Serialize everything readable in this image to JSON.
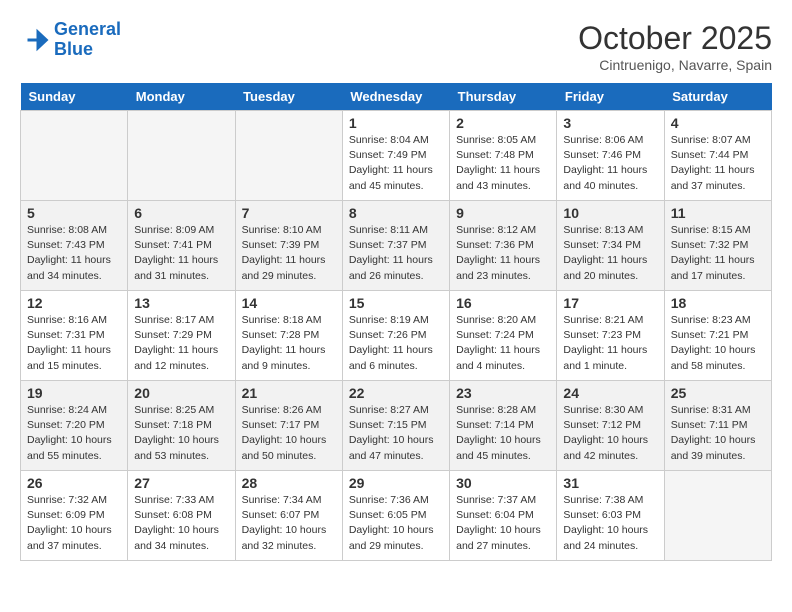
{
  "header": {
    "logo_line1": "General",
    "logo_line2": "Blue",
    "month": "October 2025",
    "location": "Cintruenigo, Navarre, Spain"
  },
  "weekdays": [
    "Sunday",
    "Monday",
    "Tuesday",
    "Wednesday",
    "Thursday",
    "Friday",
    "Saturday"
  ],
  "weeks": [
    [
      {
        "day": "",
        "info": ""
      },
      {
        "day": "",
        "info": ""
      },
      {
        "day": "",
        "info": ""
      },
      {
        "day": "1",
        "info": "Sunrise: 8:04 AM\nSunset: 7:49 PM\nDaylight: 11 hours and 45 minutes."
      },
      {
        "day": "2",
        "info": "Sunrise: 8:05 AM\nSunset: 7:48 PM\nDaylight: 11 hours and 43 minutes."
      },
      {
        "day": "3",
        "info": "Sunrise: 8:06 AM\nSunset: 7:46 PM\nDaylight: 11 hours and 40 minutes."
      },
      {
        "day": "4",
        "info": "Sunrise: 8:07 AM\nSunset: 7:44 PM\nDaylight: 11 hours and 37 minutes."
      }
    ],
    [
      {
        "day": "5",
        "info": "Sunrise: 8:08 AM\nSunset: 7:43 PM\nDaylight: 11 hours and 34 minutes."
      },
      {
        "day": "6",
        "info": "Sunrise: 8:09 AM\nSunset: 7:41 PM\nDaylight: 11 hours and 31 minutes."
      },
      {
        "day": "7",
        "info": "Sunrise: 8:10 AM\nSunset: 7:39 PM\nDaylight: 11 hours and 29 minutes."
      },
      {
        "day": "8",
        "info": "Sunrise: 8:11 AM\nSunset: 7:37 PM\nDaylight: 11 hours and 26 minutes."
      },
      {
        "day": "9",
        "info": "Sunrise: 8:12 AM\nSunset: 7:36 PM\nDaylight: 11 hours and 23 minutes."
      },
      {
        "day": "10",
        "info": "Sunrise: 8:13 AM\nSunset: 7:34 PM\nDaylight: 11 hours and 20 minutes."
      },
      {
        "day": "11",
        "info": "Sunrise: 8:15 AM\nSunset: 7:32 PM\nDaylight: 11 hours and 17 minutes."
      }
    ],
    [
      {
        "day": "12",
        "info": "Sunrise: 8:16 AM\nSunset: 7:31 PM\nDaylight: 11 hours and 15 minutes."
      },
      {
        "day": "13",
        "info": "Sunrise: 8:17 AM\nSunset: 7:29 PM\nDaylight: 11 hours and 12 minutes."
      },
      {
        "day": "14",
        "info": "Sunrise: 8:18 AM\nSunset: 7:28 PM\nDaylight: 11 hours and 9 minutes."
      },
      {
        "day": "15",
        "info": "Sunrise: 8:19 AM\nSunset: 7:26 PM\nDaylight: 11 hours and 6 minutes."
      },
      {
        "day": "16",
        "info": "Sunrise: 8:20 AM\nSunset: 7:24 PM\nDaylight: 11 hours and 4 minutes."
      },
      {
        "day": "17",
        "info": "Sunrise: 8:21 AM\nSunset: 7:23 PM\nDaylight: 11 hours and 1 minute."
      },
      {
        "day": "18",
        "info": "Sunrise: 8:23 AM\nSunset: 7:21 PM\nDaylight: 10 hours and 58 minutes."
      }
    ],
    [
      {
        "day": "19",
        "info": "Sunrise: 8:24 AM\nSunset: 7:20 PM\nDaylight: 10 hours and 55 minutes."
      },
      {
        "day": "20",
        "info": "Sunrise: 8:25 AM\nSunset: 7:18 PM\nDaylight: 10 hours and 53 minutes."
      },
      {
        "day": "21",
        "info": "Sunrise: 8:26 AM\nSunset: 7:17 PM\nDaylight: 10 hours and 50 minutes."
      },
      {
        "day": "22",
        "info": "Sunrise: 8:27 AM\nSunset: 7:15 PM\nDaylight: 10 hours and 47 minutes."
      },
      {
        "day": "23",
        "info": "Sunrise: 8:28 AM\nSunset: 7:14 PM\nDaylight: 10 hours and 45 minutes."
      },
      {
        "day": "24",
        "info": "Sunrise: 8:30 AM\nSunset: 7:12 PM\nDaylight: 10 hours and 42 minutes."
      },
      {
        "day": "25",
        "info": "Sunrise: 8:31 AM\nSunset: 7:11 PM\nDaylight: 10 hours and 39 minutes."
      }
    ],
    [
      {
        "day": "26",
        "info": "Sunrise: 7:32 AM\nSunset: 6:09 PM\nDaylight: 10 hours and 37 minutes."
      },
      {
        "day": "27",
        "info": "Sunrise: 7:33 AM\nSunset: 6:08 PM\nDaylight: 10 hours and 34 minutes."
      },
      {
        "day": "28",
        "info": "Sunrise: 7:34 AM\nSunset: 6:07 PM\nDaylight: 10 hours and 32 minutes."
      },
      {
        "day": "29",
        "info": "Sunrise: 7:36 AM\nSunset: 6:05 PM\nDaylight: 10 hours and 29 minutes."
      },
      {
        "day": "30",
        "info": "Sunrise: 7:37 AM\nSunset: 6:04 PM\nDaylight: 10 hours and 27 minutes."
      },
      {
        "day": "31",
        "info": "Sunrise: 7:38 AM\nSunset: 6:03 PM\nDaylight: 10 hours and 24 minutes."
      },
      {
        "day": "",
        "info": ""
      }
    ]
  ]
}
